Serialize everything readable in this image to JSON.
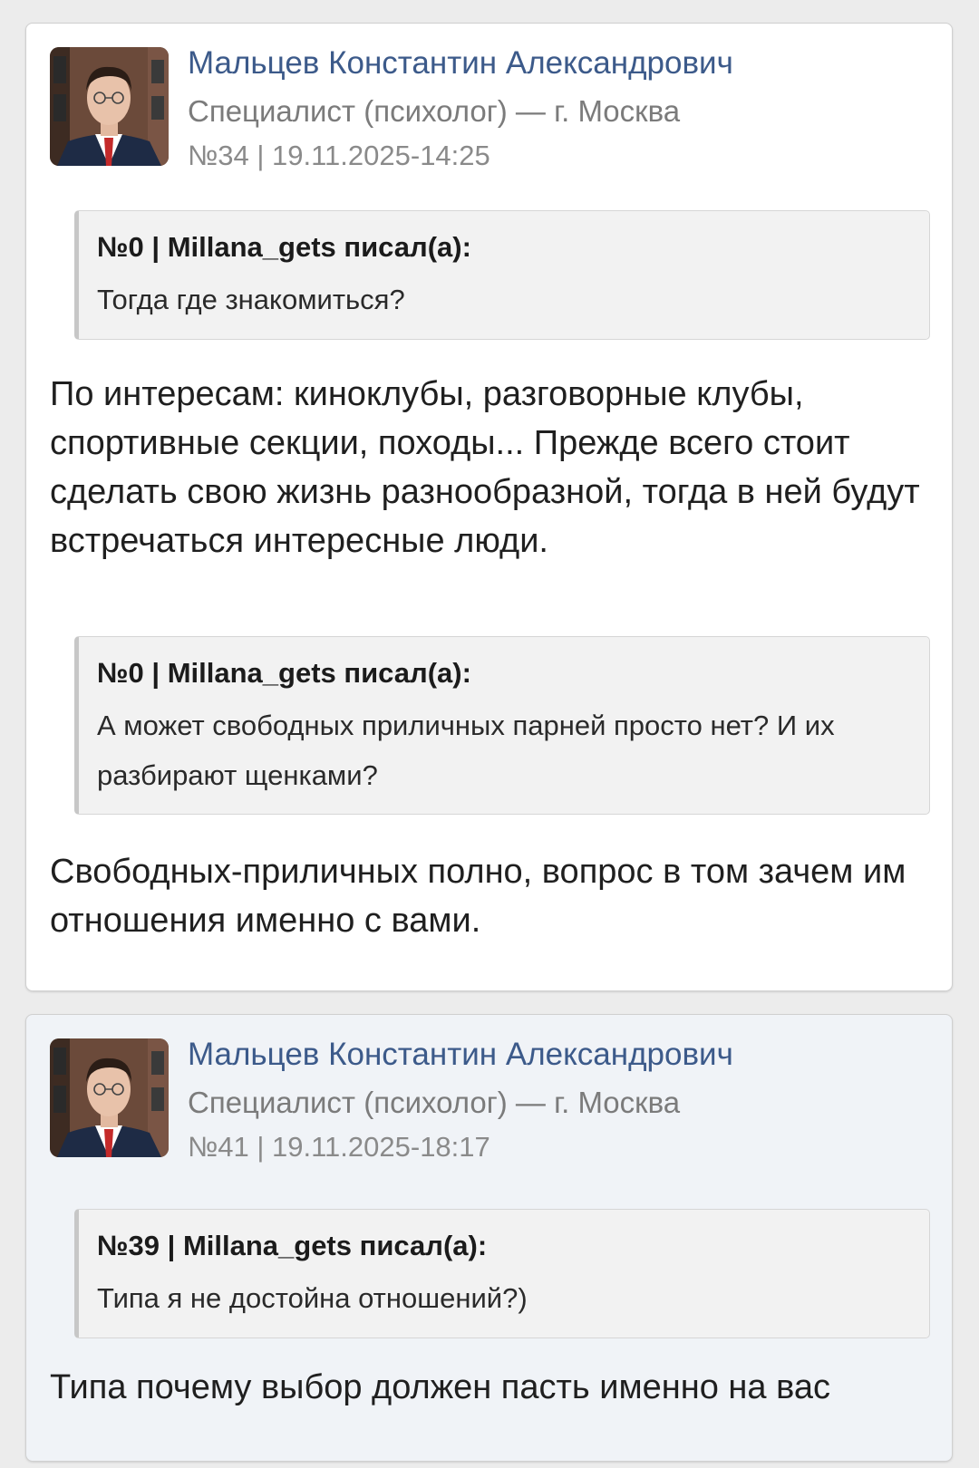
{
  "posts": [
    {
      "author": "Мальцев Константин Александрович",
      "role": "Специалист (психолог) — г. Москва",
      "meta": "№34 | 19.11.2025-14:25",
      "blocks": [
        {
          "quote_header": "№0 | Millana_gets писал(а):",
          "quote_text": "Тогда где знакомиться?",
          "reply": "По интересам: киноклубы, разговорные клубы, спортивные секции, походы... Прежде всего стоит сделать свою жизнь разнообразной, тогда в ней будут встречаться интересные люди."
        },
        {
          "quote_header": "№0 | Millana_gets писал(а):",
          "quote_text": "А может свободных приличных парней просто нет? И их разбирают щенками?",
          "reply": "Свободных-приличных полно, вопрос в том зачем им отношения именно с вами."
        }
      ]
    },
    {
      "author": "Мальцев Константин Александрович",
      "role": "Специалист (психолог) — г. Москва",
      "meta": "№41 | 19.11.2025-18:17",
      "blocks": [
        {
          "quote_header": "№39 | Millana_gets писал(а):",
          "quote_text": "Типа я не достойна отношений?)",
          "reply": "Типа почему выбор должен пасть именно на вас"
        }
      ]
    }
  ]
}
